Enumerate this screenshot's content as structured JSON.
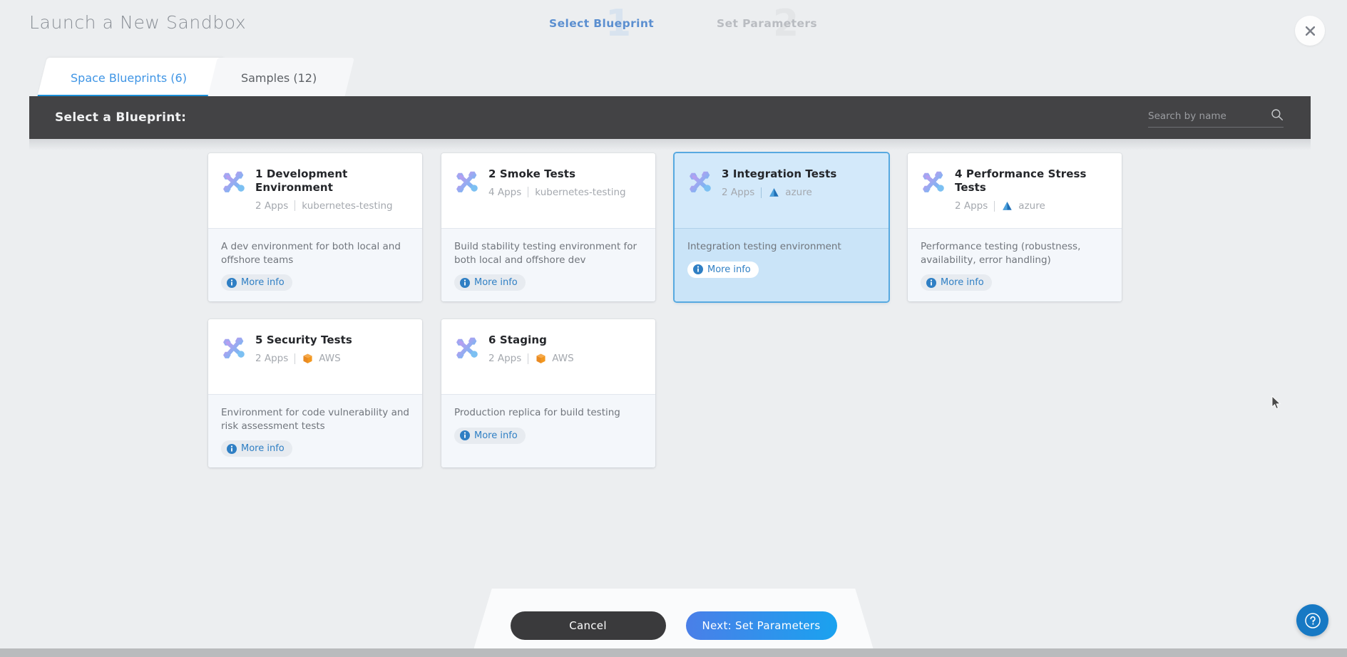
{
  "header": {
    "title": "Launch a New Sandbox",
    "close_icon": "close-icon",
    "steps": [
      {
        "number": "1",
        "label": "Select Blueprint",
        "state": "active"
      },
      {
        "number": "2",
        "label": "Set Parameters",
        "state": "inactive"
      }
    ]
  },
  "tabs": [
    {
      "label": "Space Blueprints (6)",
      "active": true
    },
    {
      "label": "Samples (12)",
      "active": false
    }
  ],
  "panel": {
    "title": "Select a Blueprint:",
    "search": {
      "placeholder": "Search by name",
      "value": "",
      "icon": "search-icon"
    }
  },
  "cards": [
    {
      "title": "1 Development Environment",
      "apps": "2 Apps",
      "provider": "kubernetes-testing",
      "provider_icon": "none",
      "description": "A dev environment for both local and offshore teams",
      "more_info_label": "More info",
      "selected": false
    },
    {
      "title": "2 Smoke Tests",
      "apps": "4 Apps",
      "provider": "kubernetes-testing",
      "provider_icon": "none",
      "description": "Build stability testing environment for both local and offshore dev",
      "more_info_label": "More info",
      "selected": false
    },
    {
      "title": "3 Integration Tests",
      "apps": "2 Apps",
      "provider": "azure",
      "provider_icon": "azure-icon",
      "description": "Integration testing environment",
      "more_info_label": "More info",
      "selected": true
    },
    {
      "title": "4 Performance Stress Tests",
      "apps": "2 Apps",
      "provider": "azure",
      "provider_icon": "azure-icon",
      "description": "Performance testing (robustness, availability, error handling)",
      "more_info_label": "More info",
      "selected": false
    },
    {
      "title": "5 Security Tests",
      "apps": "2 Apps",
      "provider": "AWS",
      "provider_icon": "aws-icon",
      "description": "Environment for code vulnerability and risk assessment tests",
      "more_info_label": "More info",
      "selected": false
    },
    {
      "title": "6 Staging",
      "apps": "2 Apps",
      "provider": "AWS",
      "provider_icon": "aws-icon",
      "description": "Production replica for build testing",
      "more_info_label": "More info",
      "selected": false
    }
  ],
  "footer": {
    "cancel_label": "Cancel",
    "next_label": "Next: Set Parameters",
    "help_icon": "question-mark-icon"
  },
  "colors": {
    "accent_blue": "#3f95e5",
    "tab_underline": "#1a8fd8",
    "panel_dark": "#434345",
    "page_bg": "#eceef0",
    "selected_card_bg": "#d3e9fa",
    "selected_card_border": "#57a9e0",
    "cancel_btn": "#3a3a3c",
    "next_btn_gradient_from": "#4a7fe8",
    "next_btn_gradient_to": "#1aa2ef",
    "aws_orange": "#ef9022",
    "azure_blue": "#1f6fb5",
    "help_btn": "#1779c4"
  }
}
